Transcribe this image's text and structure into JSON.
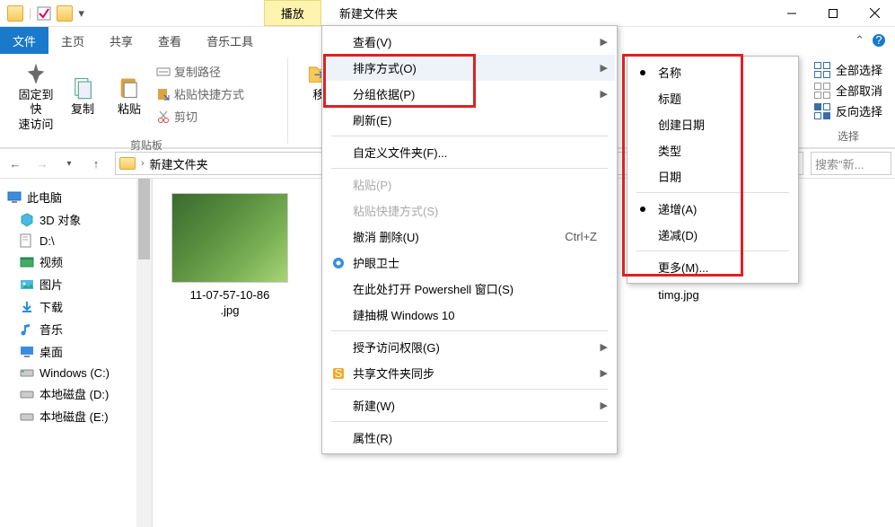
{
  "titlebar": {
    "play_tab": "播放",
    "title": "新建文件夹"
  },
  "tabs": {
    "file": "文件",
    "home": "主页",
    "share": "共享",
    "view": "查看",
    "music": "音乐工具"
  },
  "ribbon": {
    "pin": "固定到快\n速访问",
    "copy": "复制",
    "paste": "粘贴",
    "copy_path": "复制路径",
    "paste_shortcut": "粘贴快捷方式",
    "cut": "剪切",
    "clipboard_label": "剪贴板",
    "move_to": "移",
    "select_all": "全部选择",
    "select_none": "全部取消",
    "select_invert": "反向选择",
    "select_label": "选择"
  },
  "nav": {
    "crumb": "新建文件夹",
    "search_placeholder": "搜索\"新..."
  },
  "tree": {
    "root": "此电脑",
    "items": [
      "3D 对象",
      "D:\\",
      "视频",
      "图片",
      "下载",
      "音乐",
      "桌面",
      "Windows (C:)",
      "本地磁盘 (D:)",
      "本地磁盘 (E:)"
    ]
  },
  "files": {
    "item1": "11-07-57-10-86\n.jpg",
    "item2": "timg.jpg"
  },
  "ctx1": {
    "view": "查看(V)",
    "sort": "排序方式(O)",
    "group": "分组依据(P)",
    "refresh": "刷新(E)",
    "customize": "自定义文件夹(F)...",
    "paste": "粘贴(P)",
    "paste_shortcut": "粘贴快捷方式(S)",
    "undo": "撤消 删除(U)",
    "undo_sc": "Ctrl+Z",
    "protect": "护眼卫士",
    "powershell": "在此处打开 Powershell 窗口(S)",
    "win10": "鏈抽槻 Windows 10",
    "access": "授予访问权限(G)",
    "sync": "共享文件夹同步",
    "new": "新建(W)",
    "props": "属性(R)"
  },
  "ctx2": {
    "name": "名称",
    "title": "标题",
    "created": "创建日期",
    "type": "类型",
    "date": "日期",
    "asc": "递增(A)",
    "desc": "递减(D)",
    "more": "更多(M)..."
  }
}
